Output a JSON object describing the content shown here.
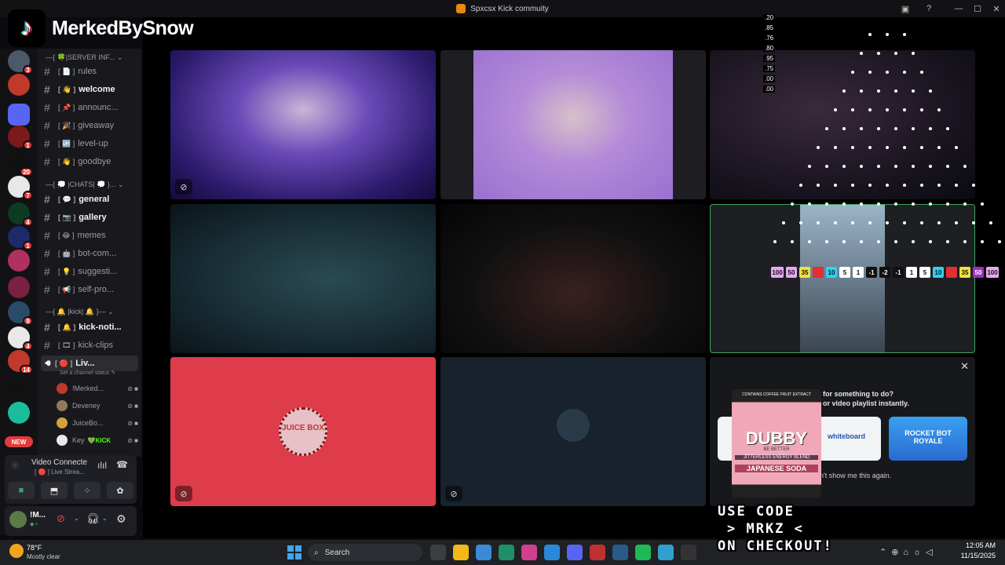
{
  "window": {
    "title": "Spxcsx Kick commuity"
  },
  "overlay": {
    "brand": "MerkedBySnow",
    "promo_lines": [
      "USE CODE",
      "> MRKZ <",
      "ON CHECKOUT!"
    ],
    "product": {
      "brand": "DUBBY",
      "tagline": "BE BETTER",
      "blend": "JITTERLESS ENERGY BLEND",
      "flavor": "JAPANESE SODA",
      "top_text": "CONTAINS COFFEE FRUIT EXTRACT"
    },
    "metrics": [
      ".20",
      ".85",
      ".76",
      ".80",
      ".95",
      ".75",
      ".00",
      ".00"
    ],
    "chips": [
      "100",
      "50",
      "35",
      "",
      "10",
      "5",
      "1",
      "-1",
      "-2",
      "-1",
      "1",
      "5",
      "10",
      "",
      "35",
      "50",
      "100"
    ]
  },
  "server_badges": [
    "3",
    "1",
    "20",
    "7",
    "4",
    "1",
    "9",
    "4",
    "14"
  ],
  "server_new_label": "NEW",
  "channels": {
    "categories": [
      "—{ 🍀|SERVER INF... ⌄",
      "—{ 💭 |CHATS| 💭 }... ⌄",
      "—{ 🔔 |kick| 🔔 }— ⌄"
    ],
    "items": [
      {
        "label": "rules",
        "emoji": "[ 📄 ]"
      },
      {
        "label": "welcome",
        "emoji": "[ 👋 ]"
      },
      {
        "label": "announc...",
        "emoji": "[ 📌 ]"
      },
      {
        "label": "giveaway",
        "emoji": "[ 🎉 ]"
      },
      {
        "label": "level-up",
        "emoji": "[ 🆙 ]"
      },
      {
        "label": "goodbye",
        "emoji": "[ 👋 ]"
      },
      {
        "label": "general",
        "emoji": "[ 💬 ]"
      },
      {
        "label": "gallery",
        "emoji": "[ 📷 ]"
      },
      {
        "label": "memes",
        "emoji": "[ 😂 ]"
      },
      {
        "label": "bot-com...",
        "emoji": "[ 🤖 ]"
      },
      {
        "label": "suggesti...",
        "emoji": "[ 💡 ]"
      },
      {
        "label": "self-pro...",
        "emoji": "[ 📢 ]"
      },
      {
        "label": "kick-noti...",
        "emoji": "[ 🔔 ]"
      },
      {
        "label": "kick-clips",
        "emoji": "[ 🎞 ]"
      }
    ],
    "voice_channel": {
      "label": "Liv...",
      "emoji": "[ 🔴 ]",
      "status": "Set a channel status ✎"
    },
    "voice_users": [
      {
        "name": "!Merked...",
        "color": "#c0392b"
      },
      {
        "name": "Deveney",
        "color": "#8e7c5a"
      },
      {
        "name": "JuiceBo...",
        "color": "#d4a23a"
      },
      {
        "name": "Key",
        "color": "#e8e8e8",
        "tag": "KICK"
      }
    ]
  },
  "voice_panel": {
    "status": "Video Connecte",
    "channel": "[ 🔴 ] Live Strea..."
  },
  "user_panel": {
    "name": "!M...",
    "sub": "◆ •"
  },
  "popup": {
    "line1": "for something to do?",
    "line2": "or video playlist instantly.",
    "dismiss": "n't show me this again.",
    "close": "✕",
    "whiteboard": "whiteboard",
    "game": "ROCKET BOT ROYALE"
  },
  "taskbar": {
    "weather_temp": "78°F",
    "weather_desc": "Mostly clear",
    "search": "Search",
    "time": "12:05 AM",
    "date": "11/15/2025"
  }
}
